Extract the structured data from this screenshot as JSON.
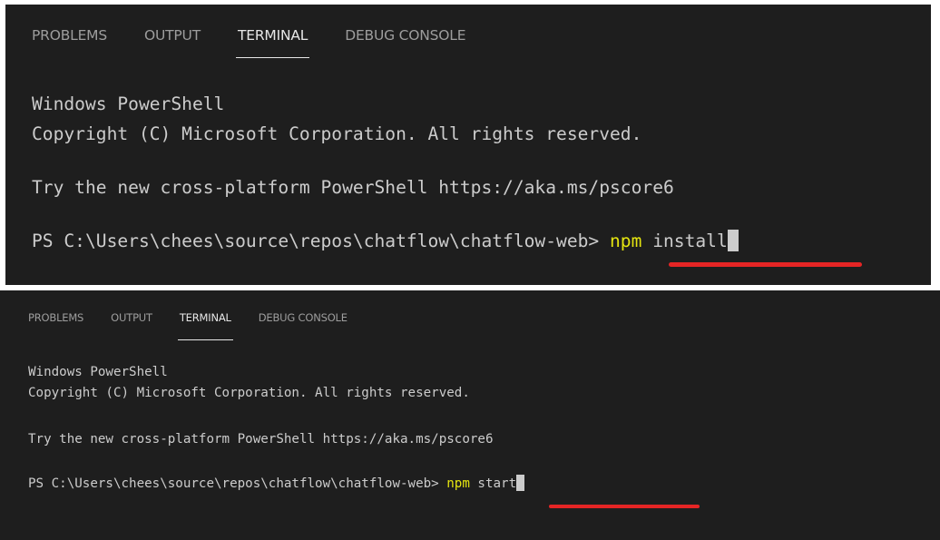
{
  "panels": [
    {
      "tabs": [
        {
          "label": "PROBLEMS"
        },
        {
          "label": "OUTPUT"
        },
        {
          "label": "TERMINAL"
        },
        {
          "label": "DEBUG CONSOLE"
        }
      ],
      "lines": {
        "banner": "Windows PowerShell",
        "copyright": "Copyright (C) Microsoft Corporation. All rights reserved.",
        "hint": "Try the new cross-platform PowerShell https://aka.ms/pscore6",
        "prompt": "PS C:\\Users\\chees\\source\\repos\\chatflow\\chatflow-web> ",
        "command": "npm",
        "argument": " install"
      }
    },
    {
      "tabs": [
        {
          "label": "PROBLEMS"
        },
        {
          "label": "OUTPUT"
        },
        {
          "label": "TERMINAL"
        },
        {
          "label": "DEBUG CONSOLE"
        }
      ],
      "lines": {
        "banner": "Windows PowerShell",
        "copyright": "Copyright (C) Microsoft Corporation. All rights reserved.",
        "hint": "Try the new cross-platform PowerShell https://aka.ms/pscore6",
        "prompt": "PS C:\\Users\\chees\\source\\repos\\chatflow\\chatflow-web> ",
        "command": "npm",
        "argument": " start"
      }
    }
  ],
  "active_tab": "TERMINAL",
  "colors": {
    "background": "#1e1e1e",
    "text": "#cccccc",
    "command": "#e5e510",
    "annotation": "#e52525"
  }
}
